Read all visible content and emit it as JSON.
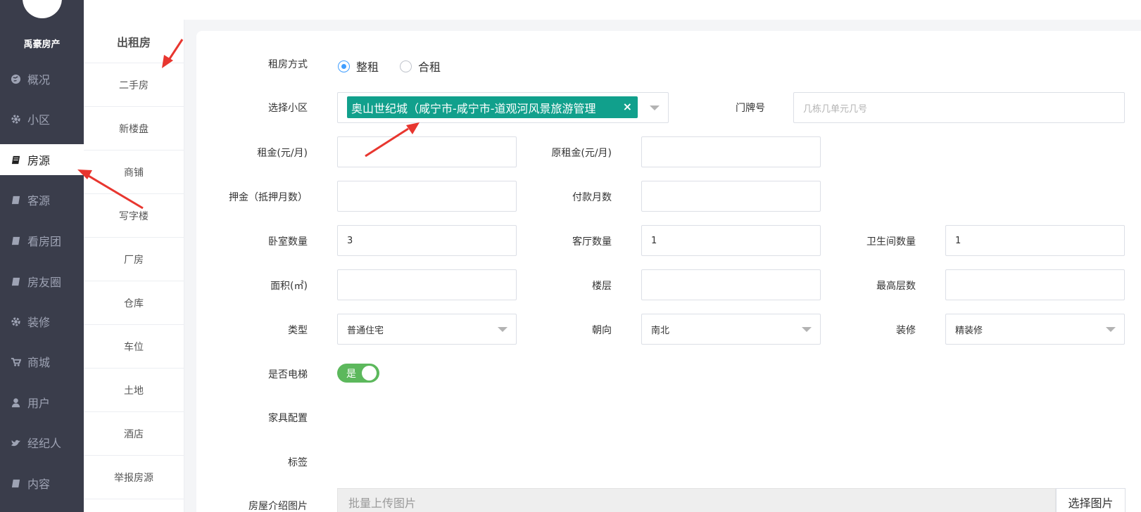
{
  "brand": "禹豪房产",
  "nav": [
    {
      "label": "概况",
      "icon": "globe-icon",
      "active": false
    },
    {
      "label": "小区",
      "icon": "gear-icon",
      "active": false
    },
    {
      "label": "房源",
      "icon": "book-icon",
      "active": true
    },
    {
      "label": "客源",
      "icon": "book-icon",
      "active": false
    },
    {
      "label": "看房团",
      "icon": "book-icon",
      "active": false
    },
    {
      "label": "房友圈",
      "icon": "book-icon",
      "active": false
    },
    {
      "label": "装修",
      "icon": "gear-icon",
      "active": false
    },
    {
      "label": "商城",
      "icon": "cart-icon",
      "active": false
    },
    {
      "label": "用户",
      "icon": "user-icon",
      "active": false
    },
    {
      "label": "经纪人",
      "icon": "bird-icon",
      "active": false
    },
    {
      "label": "内容",
      "icon": "book-icon",
      "active": false
    }
  ],
  "submenu": {
    "title": "出租房",
    "items": [
      "二手房",
      "新楼盘",
      "商铺",
      "写字楼",
      "厂房",
      "仓库",
      "车位",
      "土地",
      "酒店",
      "举报房源"
    ]
  },
  "form": {
    "rent_mode": {
      "label": "租房方式",
      "options": [
        "整租",
        "合租"
      ],
      "selected": "整租"
    },
    "community": {
      "label": "选择小区",
      "tag": "奥山世纪城（咸宁市-咸宁市-道观河风景旅游管理",
      "remove": "×"
    },
    "door_number": {
      "label": "门牌号",
      "placeholder": "几栋几单元几号"
    },
    "rent": {
      "label": "租金(元/月)",
      "value": ""
    },
    "original_rent": {
      "label": "原租金(元/月)",
      "value": ""
    },
    "deposit": {
      "label": "押金（抵押月数）",
      "value": ""
    },
    "pay_months": {
      "label": "付款月数",
      "value": ""
    },
    "bedrooms": {
      "label": "卧室数量",
      "value": "3"
    },
    "living_rooms": {
      "label": "客厅数量",
      "value": "1"
    },
    "bathrooms": {
      "label": "卫生间数量",
      "value": "1"
    },
    "area": {
      "label": "面积(㎡)",
      "value": ""
    },
    "floor": {
      "label": "楼层",
      "value": ""
    },
    "max_floor": {
      "label": "最高层数",
      "value": ""
    },
    "type": {
      "label": "类型",
      "value": "普通住宅"
    },
    "orientation": {
      "label": "朝向",
      "value": "南北"
    },
    "decoration": {
      "label": "装修",
      "value": "精装修"
    },
    "elevator": {
      "label": "是否电梯",
      "value": "是",
      "on": true
    },
    "furniture": {
      "label": "家具配置"
    },
    "tags": {
      "label": "标签"
    },
    "images": {
      "label": "房屋介绍图片",
      "placeholder": "批量上传图片",
      "button": "选择图片"
    }
  },
  "colors": {
    "sidebar": "#3a3d4b",
    "tag": "#11a08c",
    "toggle": "#5cb85c",
    "radio": "#409eff",
    "arrow": "#e8362f"
  }
}
